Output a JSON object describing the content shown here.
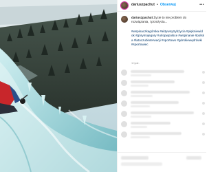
{
  "post": {
    "username": "dariuszpachut",
    "separator": "•",
    "follow_label": "Obserwuj",
    "more_label": "•••"
  },
  "caption": {
    "username": "dariuszpachut",
    "text": "Życie to nie problem do rozwiązania, i przeżycia...",
    "hashtags": "#wspinaczkagórska #aktywnytrybżycia #piękniewidok #górymojegory #urlopwpolsce #wspinanie #polska #latoczubinterwacji #sportowo #górskiewędrówki #sportowiec",
    "time_ago": "1 tydz."
  },
  "comments": [
    {
      "name": "comment-1"
    },
    {
      "name": "comment-2"
    },
    {
      "name": "comment-3"
    },
    {
      "name": "comment-4"
    },
    {
      "name": "comment-5"
    },
    {
      "name": "comment-6"
    },
    {
      "name": "comment-7"
    }
  ],
  "colors": {
    "link_blue": "#0095f6",
    "hashtag_blue": "#00376b",
    "muted": "#8e8e8e",
    "ice": "#bfe3e6",
    "forest": "#2f3a33"
  }
}
